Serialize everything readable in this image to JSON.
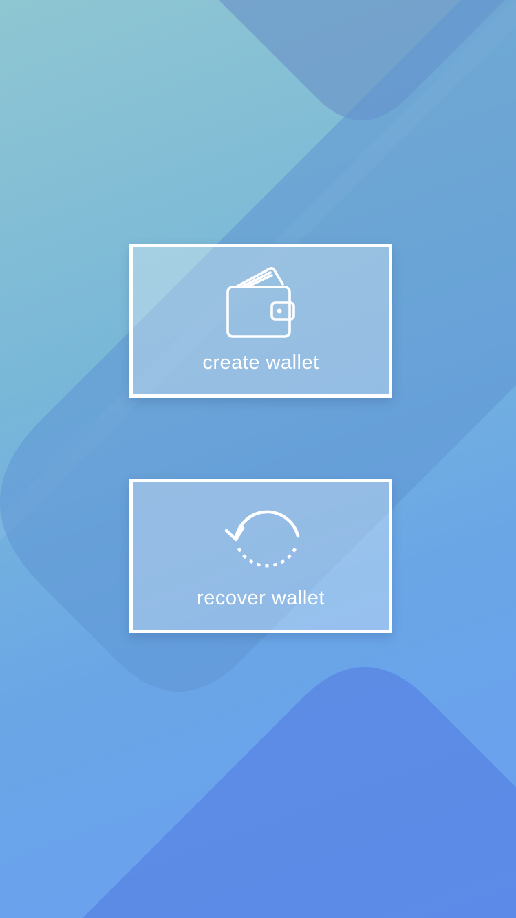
{
  "actions": {
    "create": {
      "label": "create wallet",
      "icon": "wallet-icon"
    },
    "recover": {
      "label": "recover wallet",
      "icon": "restore-icon"
    }
  },
  "colors": {
    "background_top": "#8fc6d2",
    "background_bottom": "#6b9ff3",
    "card_border": "#ffffff",
    "text": "#ffffff"
  }
}
